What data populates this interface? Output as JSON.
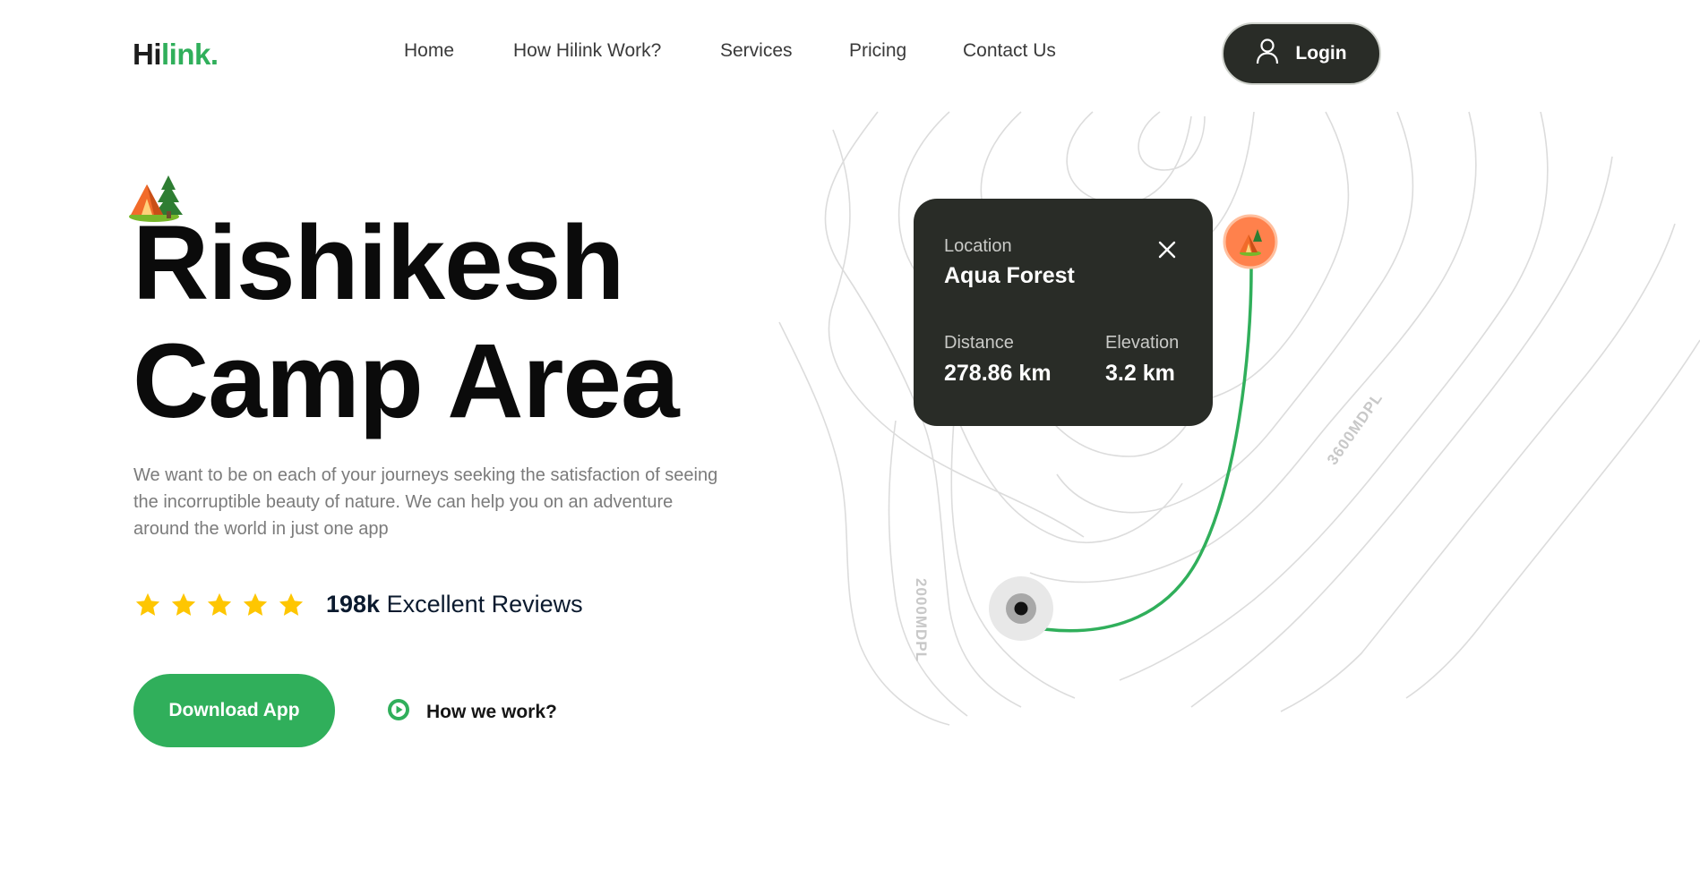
{
  "header": {
    "logo_part1": "Hi",
    "logo_part2": "link.",
    "nav": [
      "Home",
      "How Hilink Work?",
      "Services",
      "Pricing",
      "Contact Us"
    ],
    "login_label": "Login"
  },
  "hero": {
    "title_line1": "Rishikesh",
    "title_line2": "Camp Area",
    "description": "We want to be on each of your journeys seeking the satisfaction of seeing the incorruptible beauty of nature. We can help you on an adventure around the world in just one app",
    "rating_stars": 5,
    "reviews_count": "198k",
    "reviews_label": "Excellent Reviews",
    "download_label": "Download App",
    "how_label": "How we work?"
  },
  "map": {
    "location_label": "Location",
    "location_name": "Aqua Forest",
    "distance_label": "Distance",
    "distance_value": "278.86 km",
    "elevation_label": "Elevation",
    "elevation_value": "3.2 km",
    "contour_label_1": "2000MDPL",
    "contour_label_2": "3600MDPL"
  },
  "colors": {
    "accent": "#30AF5B",
    "dark": "#292C27",
    "star": "#FEC601",
    "marker": "#FF814C"
  },
  "icons": [
    "user-icon",
    "camp-icon",
    "star-icon",
    "play-icon",
    "close-icon",
    "camp-marker-icon",
    "start-point-icon"
  ]
}
